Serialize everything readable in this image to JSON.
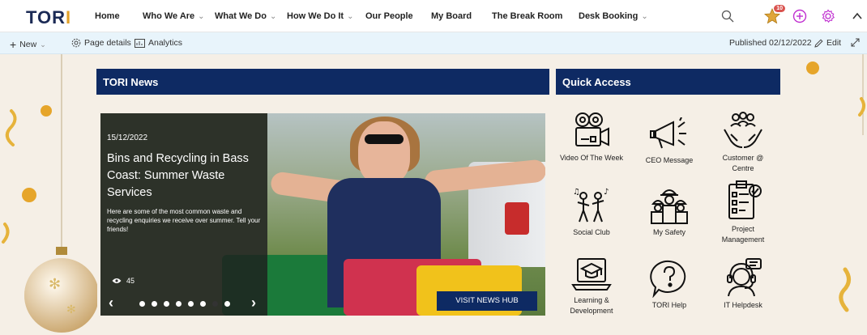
{
  "nav": {
    "logo_main": "TOR",
    "logo_accent": "I",
    "items": [
      {
        "label": "Home",
        "dropdown": false
      },
      {
        "label": "Who We Are",
        "dropdown": true
      },
      {
        "label": "What We Do",
        "dropdown": true
      },
      {
        "label": "How We Do It",
        "dropdown": true
      },
      {
        "label": "Our People",
        "dropdown": false
      },
      {
        "label": "My Board",
        "dropdown": false
      },
      {
        "label": "The Break Room",
        "dropdown": false
      },
      {
        "label": "Desk Booking",
        "dropdown": true
      }
    ],
    "notification_count": "10",
    "icons": [
      "search-icon",
      "star-badge-icon",
      "add-circle-icon",
      "settings-icon",
      "collapse-chevron-icon"
    ]
  },
  "command_bar": {
    "new_label": "New",
    "page_details_label": "Page details",
    "analytics_label": "Analytics",
    "published_label": "Published 02/12/2022",
    "edit_label": "Edit"
  },
  "news": {
    "header": "TORI News",
    "date": "15/12/2022",
    "title": "Bins and Recycling in Bass Coast: Summer Waste Services",
    "description": "Here are some of the most common waste and recycling enquiries we receive over summer. Tell your friends!",
    "views": "45",
    "hub_button": "VISIT NEWS HUB",
    "active_dot": 6
  },
  "quick_access": {
    "header": "Quick Access",
    "tiles": [
      {
        "label": "Video Of The Week",
        "icon": "video-camera-icon"
      },
      {
        "label": "CEO Message",
        "icon": "megaphone-icon"
      },
      {
        "label": "Customer @ Centre",
        "icon": "customer-hands-icon"
      },
      {
        "label": "Social Club",
        "icon": "dancing-people-icon"
      },
      {
        "label": "My Safety",
        "icon": "hard-hat-workers-icon"
      },
      {
        "label": "Project Management",
        "icon": "checklist-icon"
      },
      {
        "label": "Learning & Development",
        "icon": "graduation-laptop-icon"
      },
      {
        "label": "TORI Help",
        "icon": "question-bubble-icon"
      },
      {
        "label": "IT Helpdesk",
        "icon": "headset-support-icon"
      }
    ]
  },
  "colors": {
    "brand_navy": "#0e2a63",
    "accent_gold": "#e2a129",
    "cmdbar_bg": "#e8f4fb",
    "page_bg": "#f5efe6"
  }
}
